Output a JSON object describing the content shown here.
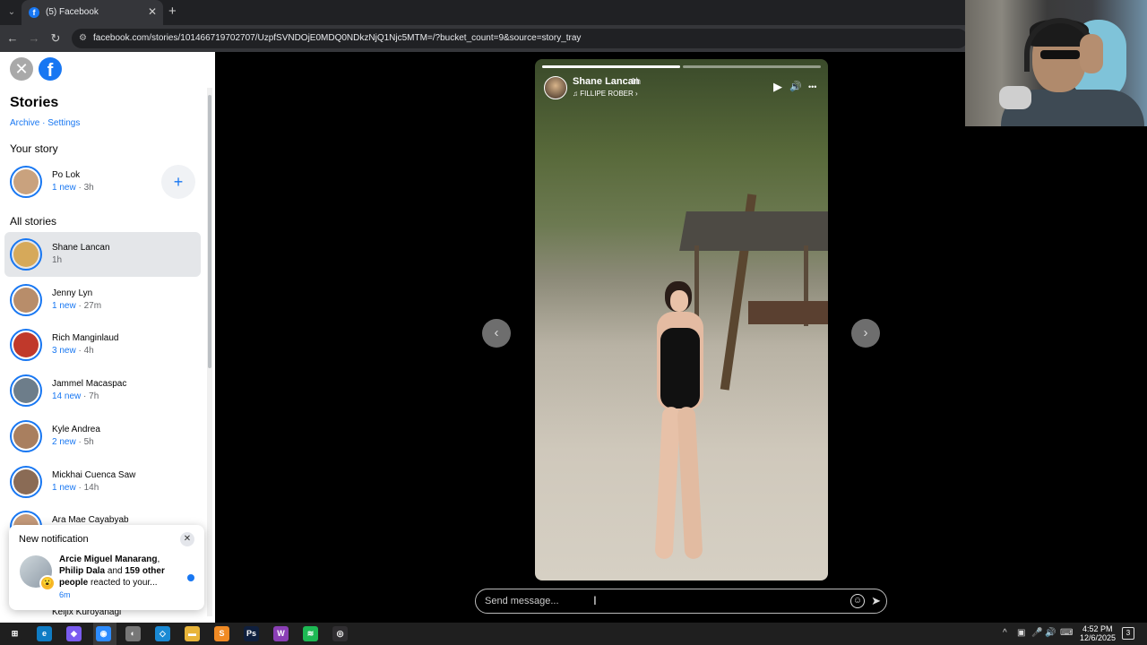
{
  "browser": {
    "tab_title": "(5) Facebook",
    "tab_favicon": "f",
    "url": "facebook.com/stories/101466719702707/UzpfSVNDOjE0MDQ0NDkzNjQ1Njc5MTM=/?bucket_count=9&source=story_tray",
    "new_tab_symbol": "+",
    "close_tab_symbol": "✕",
    "icons": [
      "tab-search-icon",
      "back-icon",
      "forward-icon",
      "reload-icon",
      "site-info-icon"
    ]
  },
  "sidebar": {
    "close_symbol": "✕",
    "logo_letter": "f",
    "title": "Stories",
    "links": "Archive · Settings",
    "your_story_label": "Your story",
    "your_story": {
      "name": "Po Lok",
      "new": "1 new",
      "time": " · 3h"
    },
    "add_symbol": "+",
    "all_stories_label": "All stories",
    "stories": [
      {
        "name": "Shane Lancan",
        "new": "",
        "time": "1h"
      },
      {
        "name": "Jenny Lyn",
        "new": "1 new",
        "time": " · 27m"
      },
      {
        "name": "Rich Manginlaud",
        "new": "3 new",
        "time": " · 4h"
      },
      {
        "name": "Jammel Macaspac",
        "new": "14 new",
        "time": " · 7h"
      },
      {
        "name": "Kyle Andrea",
        "new": "2 new",
        "time": " · 5h"
      },
      {
        "name": "Mickhai Cuenca Saw",
        "new": "1 new",
        "time": " · 14h"
      },
      {
        "name": "Ara Mae Cayabyab",
        "new": "",
        "time": ""
      }
    ],
    "partial_item": "Keijix Kuroyanagi",
    "avatar_colors": [
      "#c9a27e",
      "#d6a95a",
      "#b88d6a",
      "#c0392b",
      "#6d7d8a",
      "#a97f5f",
      "#8a6b55",
      "#c49a7a"
    ]
  },
  "notification": {
    "title": "New notification",
    "close_symbol": "✕",
    "actor1": "Arcie Miguel Manarang",
    "sep1": ", ",
    "actor2": "Philip Dala",
    "and": " and ",
    "others": "159 other people",
    "rest": " reacted to your...",
    "time": "6m",
    "emoji": "😮"
  },
  "story": {
    "author": "Shane Lancan",
    "time": "1h",
    "music": "♫ FILLIPE ROBER ›",
    "progress": [
      1.0,
      0.0
    ],
    "play_symbol": "▶",
    "mute_symbol": "🔊",
    "more_symbol": "•••",
    "prev_symbol": "‹",
    "next_symbol": "›"
  },
  "message": {
    "placeholder": "Send message...",
    "emoji_symbol": "☺",
    "send_symbol": "➤",
    "cursor_symbol": "I"
  },
  "taskbar": {
    "apps": [
      {
        "icon": "windows-start-icon",
        "glyph": "⊞",
        "color": "#1f1f1f"
      },
      {
        "icon": "edge-icon",
        "glyph": "e",
        "color": "#0f7cc4"
      },
      {
        "icon": "copilot-icon",
        "glyph": "◆",
        "color": "#7a5cf0"
      },
      {
        "icon": "chrome-icon",
        "glyph": "◉",
        "color": "#2d8cff"
      },
      {
        "icon": "app-icon",
        "glyph": "◐",
        "color": "#777"
      },
      {
        "icon": "vscode-icon",
        "glyph": "◇",
        "color": "#1a8ad4"
      },
      {
        "icon": "file-explorer-icon",
        "glyph": "▬",
        "color": "#e8b43a"
      },
      {
        "icon": "sublime-icon",
        "glyph": "S",
        "color": "#f08a24"
      },
      {
        "icon": "photoshop-icon",
        "glyph": "Ps",
        "color": "#0f1f3d"
      },
      {
        "icon": "visual-studio-icon",
        "glyph": "W",
        "color": "#8a3fb5"
      },
      {
        "icon": "spotify-icon",
        "glyph": "≋",
        "color": "#1db954"
      },
      {
        "icon": "obs-icon",
        "glyph": "◎",
        "color": "#302e31"
      }
    ],
    "tray": [
      "^",
      "▣",
      "🎤",
      "🔊",
      "⌨"
    ],
    "time": "4:52 PM",
    "date": "12/6/2025",
    "notification_count": "3"
  }
}
